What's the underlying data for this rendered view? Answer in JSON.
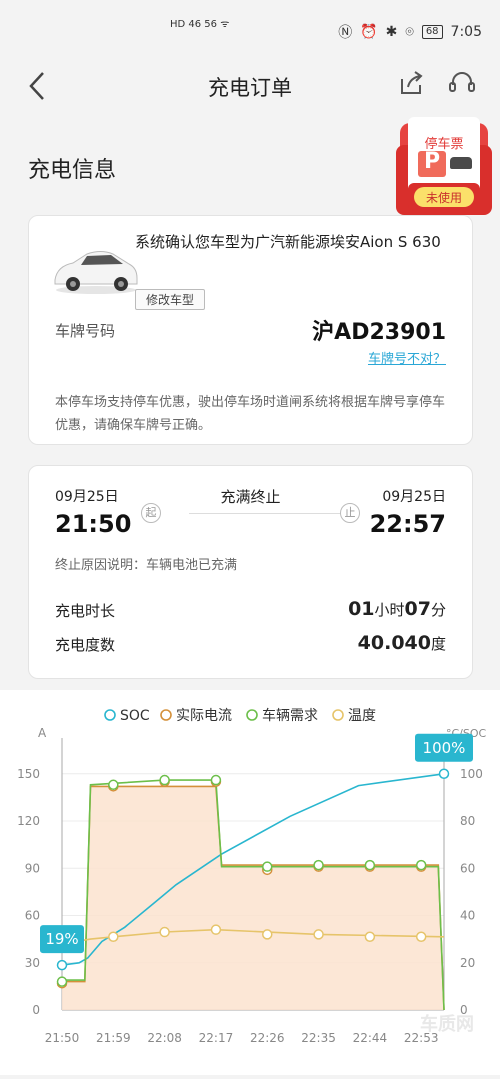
{
  "status_bar": {
    "left": "HD 46 56 ᯤ",
    "time": "7:05",
    "battery": "68"
  },
  "nav": {
    "title": "充电订单"
  },
  "section_title": "充电信息",
  "ticket": {
    "title": "停车票",
    "letter": "P",
    "status": "未使用"
  },
  "car_card": {
    "confirm_text": "系统确认您车型为广汽新能源埃安Aion S 630",
    "modify_button": "修改车型",
    "plate_label": "车牌号码",
    "plate_value": "沪AD23901",
    "plate_wrong": "车牌号不对？",
    "notice": "本停车场支持停车优惠，驶出停车场时道闸系统将根据车牌号享停车优惠，请确保车牌号正确。"
  },
  "session_card": {
    "start_date": "09月25日",
    "start_time": "21:50",
    "start_badge": "起",
    "status": "充满终止",
    "end_date": "09月25日",
    "end_time": "22:57",
    "end_badge": "止",
    "reason": "终止原因说明：车辆电池已充满",
    "duration_label": "充电时长",
    "duration_hours": "01",
    "duration_hours_unit": "小时",
    "duration_minutes": "07",
    "duration_minutes_unit": "分",
    "energy_label": "充电度数",
    "energy_value": "40.040",
    "energy_unit": "度"
  },
  "chart_data": {
    "type": "line",
    "left_axis_unit": "A",
    "right_axis_unit": "°C/SOC",
    "left_ylim": [
      0,
      160
    ],
    "left_ticks": [
      0,
      30,
      60,
      90,
      120,
      150
    ],
    "right_ticks": [
      0,
      20,
      40,
      60,
      80,
      100
    ],
    "x_ticks": [
      "21:50",
      "21:59",
      "22:08",
      "22:17",
      "22:26",
      "22:35",
      "22:44",
      "22:53"
    ],
    "x_range_minutes": [
      0,
      67
    ],
    "legend_position": "top",
    "series": [
      {
        "name": "SOC",
        "color": "#29b6cf",
        "axis": "right",
        "points": [
          [
            0,
            19
          ],
          [
            3,
            20
          ],
          [
            4.5,
            22
          ],
          [
            7,
            29
          ],
          [
            11,
            35
          ],
          [
            16,
            45
          ],
          [
            20,
            53
          ],
          [
            28,
            66
          ],
          [
            40,
            82
          ],
          [
            52,
            95
          ],
          [
            67,
            100
          ]
        ]
      },
      {
        "name": "实际电流",
        "color": "#d4903a",
        "axis": "left",
        "fill": "#fbe3cf",
        "points": [
          [
            0,
            18
          ],
          [
            4,
            18
          ],
          [
            5,
            142
          ],
          [
            27,
            142
          ],
          [
            28,
            92
          ],
          [
            66,
            92
          ],
          [
            67,
            0
          ]
        ]
      },
      {
        "name": "车辆需求",
        "color": "#6cbf4a",
        "axis": "left",
        "points": [
          [
            0,
            19
          ],
          [
            4,
            19
          ],
          [
            5,
            143
          ],
          [
            18,
            146
          ],
          [
            27,
            146
          ],
          [
            28,
            91
          ],
          [
            66,
            91
          ],
          [
            67,
            0
          ]
        ]
      },
      {
        "name": "温度",
        "color": "#e6c46a",
        "axis": "right",
        "points": [
          [
            0,
            28
          ],
          [
            5,
            30
          ],
          [
            9,
            31
          ],
          [
            18,
            33
          ],
          [
            27,
            34
          ],
          [
            45,
            32
          ],
          [
            67,
            31
          ]
        ]
      }
    ],
    "markers": {
      "实际电流": [
        [
          0,
          17
        ],
        [
          9,
          142
        ],
        [
          18,
          145
        ],
        [
          27,
          145
        ],
        [
          36,
          89
        ],
        [
          45,
          91
        ],
        [
          54,
          91
        ],
        [
          63,
          91
        ]
      ],
      "车辆需求": [
        [
          0,
          18
        ],
        [
          9,
          143
        ],
        [
          18,
          146
        ],
        [
          27,
          146
        ],
        [
          36,
          91
        ],
        [
          45,
          92
        ],
        [
          54,
          92
        ],
        [
          63,
          92
        ]
      ],
      "温度": [
        [
          0,
          28
        ],
        [
          9,
          31
        ],
        [
          18,
          33
        ],
        [
          27,
          34
        ],
        [
          36,
          32
        ],
        [
          45,
          32
        ],
        [
          54,
          31
        ],
        [
          63,
          31
        ]
      ],
      "SOC": [
        [
          0,
          19
        ],
        [
          67,
          100
        ]
      ]
    },
    "callouts": [
      {
        "text": "19%",
        "series": "SOC",
        "x": 0,
        "y": 19
      },
      {
        "text": "100%",
        "series": "SOC",
        "x": 67,
        "y": 100
      }
    ]
  },
  "watermark": "车质网"
}
